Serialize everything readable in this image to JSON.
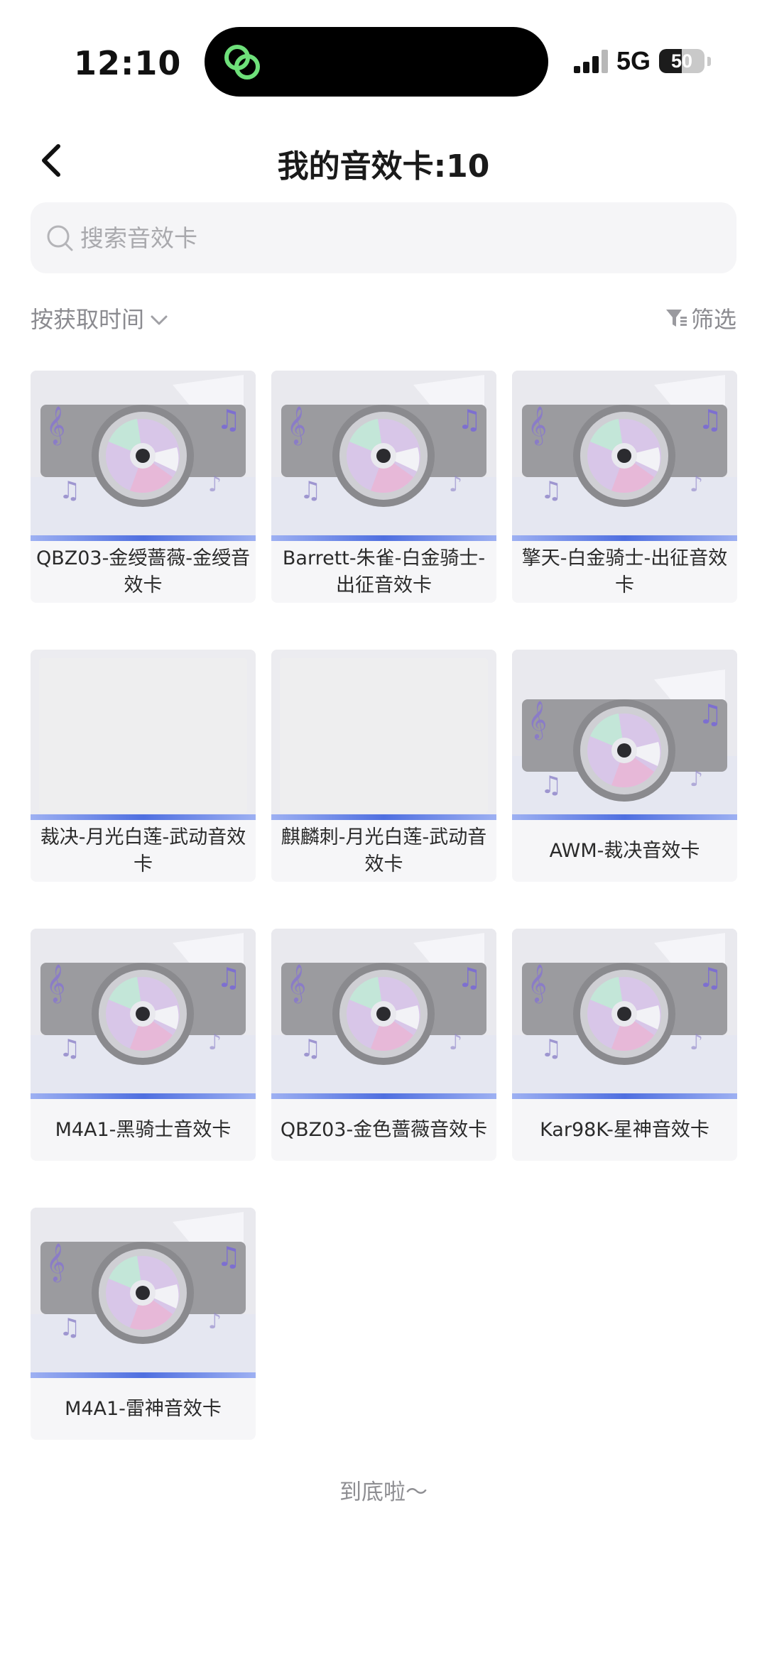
{
  "status_bar": {
    "time": "12:10",
    "network": "5G",
    "battery": "50",
    "battery_level": 0.5,
    "island_icon": "app-link-icon"
  },
  "header": {
    "title": "我的音效卡:10",
    "back_icon": "back-arrow-icon"
  },
  "search": {
    "placeholder": "搜索音效卡",
    "value": ""
  },
  "toolbar": {
    "sort_label": "按获取时间",
    "filter_label": "筛选"
  },
  "cards": [
    {
      "label": "QBZ03-金绶蔷薇-金绶音效卡",
      "thumb": "disc"
    },
    {
      "label": "Barrett-朱雀-白金骑士-出征音效卡",
      "thumb": "disc"
    },
    {
      "label": "擎天-白金骑士-出征音效卡",
      "thumb": "disc"
    },
    {
      "label": "裁决-月光白莲-武动音效卡",
      "thumb": "blank"
    },
    {
      "label": "麒麟刺-月光白莲-武动音效卡",
      "thumb": "blank"
    },
    {
      "label": "AWM-裁决音效卡",
      "thumb": "disc-low"
    },
    {
      "label": "M4A1-黑骑士音效卡",
      "thumb": "disc"
    },
    {
      "label": "QBZ03-金色蔷薇音效卡",
      "thumb": "disc"
    },
    {
      "label": "Kar98K-星神音效卡",
      "thumb": "disc"
    },
    {
      "label": "M4A1-雷神音效卡",
      "thumb": "disc"
    }
  ],
  "footer": {
    "end_text": "到底啦～"
  }
}
